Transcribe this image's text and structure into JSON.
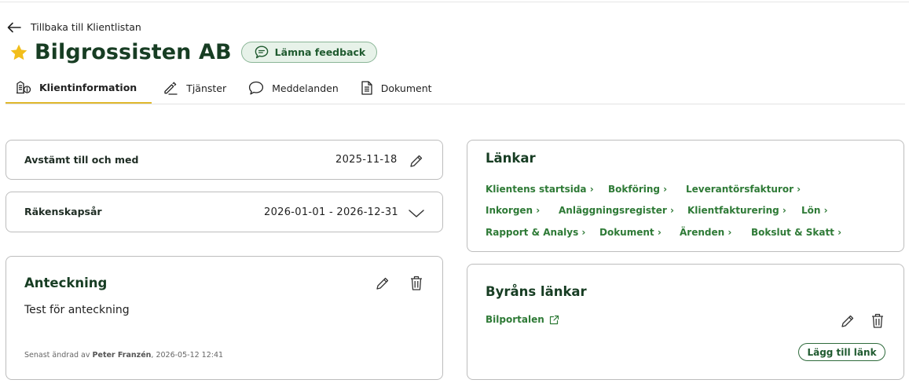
{
  "nav": {
    "back_label": "Tillbaka till Klientlistan"
  },
  "header": {
    "title": "Bilgrossisten AB",
    "feedback_label": "Lämna feedback"
  },
  "tabs": [
    {
      "label": "Klientinformation",
      "icon": "client-info-icon",
      "active": true
    },
    {
      "label": "Tjänster",
      "icon": "tools-icon",
      "active": false
    },
    {
      "label": "Meddelanden",
      "icon": "chat-icon",
      "active": false
    },
    {
      "label": "Dokument",
      "icon": "document-icon",
      "active": false
    }
  ],
  "reconciled": {
    "label": "Avstämt till och med",
    "value": "2025-11-18"
  },
  "fiscal_year": {
    "label": "Räkenskapsår",
    "value": "2026-01-01 - 2026-12-31"
  },
  "note": {
    "title": "Anteckning",
    "text": "Test för anteckning",
    "meta_prefix": "Senast ändrad av",
    "meta_author": "Peter Franzén",
    "meta_date": ", 2026-05-12 12:41"
  },
  "links": {
    "title": "Länkar",
    "rows": [
      [
        "Klientens startsida ›",
        "Bokföring ›",
        "Leverantörsfakturor ›"
      ],
      [
        "Inkorgen ›",
        "Anläggningsregister ›",
        "Klientfakturering ›",
        "Lön ›"
      ],
      [
        "Rapport & Analys ›",
        "Dokument ›",
        "Ärenden ›",
        "Bokslut & Skatt ›"
      ]
    ]
  },
  "agency_links": {
    "title": "Byråns länkar",
    "portal_label": "Bilportalen",
    "add_label": "Lägg till länk"
  },
  "colors": {
    "brand_green": "#173d23",
    "link_green": "#2e7a36",
    "accent_yellow": "#e0b92e",
    "star": "#f2be1b"
  }
}
